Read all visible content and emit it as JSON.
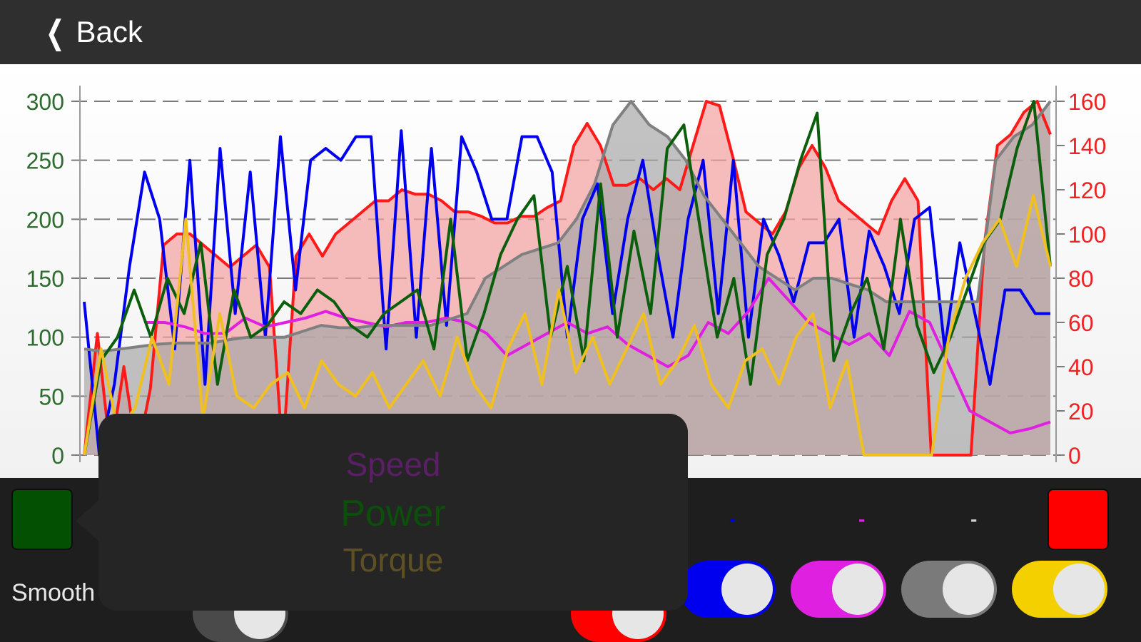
{
  "navbar": {
    "back_label": "Back"
  },
  "chart_data": {
    "type": "line",
    "left_axis": {
      "ticks": [
        "300",
        "250",
        "200",
        "150",
        "100",
        "50",
        "0"
      ],
      "ylim": [
        0,
        300
      ],
      "color": "#2e6b2e"
    },
    "right_axis": {
      "ticks": [
        "160",
        "140",
        "120",
        "100",
        "80",
        "60",
        "40",
        "20",
        "0"
      ],
      "ylim": [
        0,
        160
      ],
      "color": "#ee2222"
    },
    "grid": "dashed",
    "series": [
      {
        "color": "#ff1a1a",
        "axis": "right",
        "fill": "#f4a0a0",
        "values": [
          0,
          55,
          0,
          40,
          0,
          30,
          95,
          100,
          100,
          95,
          90,
          85,
          90,
          95,
          85,
          0,
          90,
          100,
          90,
          100,
          105,
          110,
          115,
          115,
          120,
          118,
          118,
          115,
          110,
          110,
          108,
          105,
          105,
          108,
          108,
          112,
          115,
          140,
          150,
          140,
          122,
          122,
          125,
          120,
          125,
          120,
          140,
          160,
          158,
          135,
          110,
          105,
          100,
          110,
          130,
          140,
          130,
          115,
          110,
          105,
          100,
          115,
          125,
          115,
          0,
          0,
          0,
          0,
          95,
          140,
          145,
          155,
          160,
          145
        ]
      },
      {
        "color": "#0000ee",
        "axis": "left",
        "values": [
          130,
          0,
          60,
          160,
          240,
          200,
          90,
          250,
          60,
          260,
          120,
          240,
          100,
          270,
          140,
          250,
          260,
          250,
          270,
          270,
          90,
          275,
          100,
          260,
          110,
          270,
          240,
          200,
          200,
          270,
          270,
          240,
          100,
          200,
          230,
          120,
          200,
          250,
          170,
          100,
          200,
          250,
          120,
          250,
          100,
          200,
          170,
          130,
          180,
          180,
          200,
          100,
          190,
          160,
          120,
          200,
          210,
          90,
          180,
          120,
          60,
          140,
          140,
          120,
          120
        ]
      },
      {
        "color": "#e020e0",
        "axis": "right",
        "values": [
          null,
          null,
          null,
          60,
          60,
          58,
          55,
          55,
          62,
          58,
          60,
          62,
          65,
          62,
          60,
          58,
          60,
          60,
          62,
          60,
          55,
          45,
          50,
          55,
          60,
          55,
          58,
          50,
          45,
          40,
          45,
          60,
          55,
          65,
          80,
          70,
          60,
          55,
          50,
          55,
          45,
          65,
          60,
          40,
          20,
          15,
          10,
          12,
          15
        ]
      },
      {
        "color": "#808080",
        "axis": "left",
        "fill": "#a8a8a8",
        "values": [
          90,
          88,
          90,
          92,
          94,
          95,
          95,
          95,
          98,
          100,
          100,
          100,
          105,
          110,
          108,
          108,
          110,
          110,
          110,
          110,
          115,
          120,
          150,
          160,
          170,
          175,
          180,
          200,
          230,
          280,
          300,
          280,
          270,
          250,
          220,
          200,
          180,
          160,
          150,
          140,
          150,
          150,
          145,
          140,
          130,
          130,
          130,
          130,
          130,
          130,
          250,
          270,
          280,
          300
        ]
      },
      {
        "color": "#0b5e0b",
        "axis": "left",
        "values": [
          0,
          80,
          100,
          140,
          100,
          150,
          120,
          180,
          60,
          140,
          100,
          110,
          130,
          120,
          140,
          130,
          110,
          100,
          120,
          130,
          140,
          90,
          200,
          80,
          120,
          170,
          200,
          220,
          100,
          160,
          80,
          230,
          100,
          190,
          120,
          260,
          280,
          190,
          100,
          150,
          60,
          170,
          200,
          250,
          290,
          80,
          120,
          150,
          90,
          200,
          110,
          70,
          100,
          140,
          180,
          200,
          260,
          300,
          160
        ]
      },
      {
        "color": "#f0c020",
        "axis": "left",
        "values": [
          0,
          90,
          20,
          40,
          100,
          60,
          200,
          30,
          120,
          50,
          40,
          60,
          70,
          40,
          80,
          60,
          50,
          70,
          40,
          60,
          80,
          50,
          100,
          60,
          40,
          90,
          120,
          60,
          140,
          70,
          100,
          60,
          90,
          120,
          60,
          80,
          110,
          60,
          40,
          80,
          90,
          60,
          100,
          120,
          40,
          80,
          0,
          0,
          0,
          0,
          0,
          100,
          150,
          180,
          200,
          160,
          220,
          160
        ]
      }
    ]
  },
  "bottom": {
    "power_swatch_color": "#035003",
    "right_swatch_color": "#ff0000",
    "series_dashes": [
      {
        "text": "-",
        "color": "#0000ee"
      },
      {
        "text": "-",
        "color": "#e020e0"
      },
      {
        "text": "-",
        "color": "#d0d0d0"
      }
    ],
    "smooth_label": "Smooth",
    "toggles": [
      {
        "color": "#0000ee",
        "on": true
      },
      {
        "color": "#e020e0",
        "on": true
      },
      {
        "color": "#7a7a7a",
        "on": true
      },
      {
        "color": "#f5d000",
        "on": true
      }
    ]
  },
  "popover": {
    "items": [
      {
        "label": "Speed",
        "color": "#5a1f66"
      },
      {
        "label": "Power",
        "color": "#0b4f0b"
      },
      {
        "label": "Torque",
        "color": "#5e5024"
      }
    ]
  }
}
